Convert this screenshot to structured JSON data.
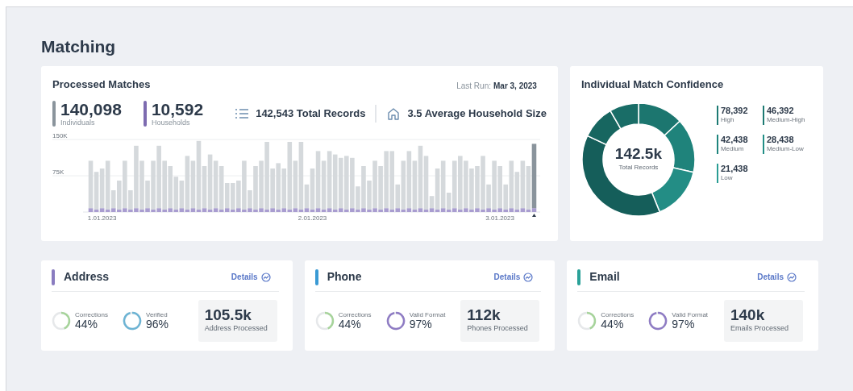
{
  "page_title": "Matching",
  "processed_matches": {
    "title": "Processed Matches",
    "last_run_label": "Last Run:",
    "last_run_value": "Mar 3, 2023",
    "stats": [
      {
        "value": "140,098",
        "label": "Individuals",
        "color": "#8a949c"
      },
      {
        "value": "10,592",
        "label": "Households",
        "color": "#7d6bb0"
      }
    ],
    "summary": [
      {
        "kind": "list",
        "text": "142,543 Total Records"
      },
      {
        "kind": "house",
        "text": "3.5 Average Household Size"
      }
    ],
    "chart_data": {
      "type": "bar",
      "stacked": true,
      "grid": true,
      "ylim": [
        0,
        150000
      ],
      "yticks": [
        {
          "value": 75000,
          "label": "75K"
        },
        {
          "value": 150000,
          "label": "150K"
        }
      ],
      "categories": [
        null,
        null,
        "1.01.2023",
        null,
        null,
        null,
        null,
        null,
        null,
        null,
        null,
        null,
        null,
        null,
        null,
        null,
        null,
        null,
        null,
        null,
        null,
        null,
        null,
        null,
        null,
        null,
        null,
        null,
        null,
        null,
        null,
        null,
        null,
        null,
        null,
        null,
        null,
        null,
        null,
        "2.01.2023",
        null,
        null,
        null,
        null,
        null,
        null,
        null,
        null,
        null,
        null,
        null,
        null,
        null,
        null,
        null,
        null,
        null,
        null,
        null,
        null,
        null,
        null,
        null,
        null,
        null,
        null,
        null,
        null,
        null,
        null,
        null,
        null,
        "3.01.2023",
        null,
        null,
        null,
        null,
        null,
        null
      ],
      "series": [
        {
          "color": "#a99dd0",
          "values": [
            8000,
            5000,
            8000,
            5000,
            8000,
            5000,
            8000,
            5000,
            8000,
            5000,
            8000,
            5000,
            8000,
            5000,
            8000,
            5000,
            8000,
            5000,
            8000,
            5000,
            8000,
            5000,
            8000,
            5000,
            8000,
            5000,
            8000,
            5000,
            8000,
            5000,
            8000,
            5000,
            8000,
            5000,
            8000,
            5000,
            8000,
            5000,
            8000,
            5000,
            8000,
            5000,
            8000,
            5000,
            8000,
            5000,
            8000,
            5000,
            8000,
            5000,
            8000,
            5000,
            8000,
            5000,
            8000,
            5000,
            8000,
            5000,
            8000,
            5000,
            8000,
            5000,
            8000,
            5000,
            8000,
            5000,
            8000,
            5000,
            8000,
            5000,
            8000,
            5000,
            8000,
            5000,
            8000,
            5000,
            8000,
            5000,
            8000
          ]
        },
        {
          "color": "#d5d9dc",
          "values": [
            98000,
            78000,
            82000,
            101000,
            37000,
            60000,
            98000,
            40000,
            129000,
            101000,
            57000,
            101000,
            129000,
            101000,
            87000,
            68000,
            57000,
            111000,
            98000,
            142000,
            87000,
            114000,
            98000,
            90000,
            52000,
            55000,
            57000,
            101000,
            37000,
            90000,
            98000,
            140000,
            82000,
            96000,
            82000,
            140000,
            98000,
            140000,
            49000,
            85000,
            118000,
            101000,
            118000,
            114000,
            104000,
            111000,
            104000,
            48000,
            87000,
            60000,
            98000,
            90000,
            118000,
            121000,
            49000,
            101000,
            118000,
            101000,
            129000,
            111000,
            25000,
            85000,
            98000,
            35000,
            98000,
            111000,
            98000,
            85000,
            87000,
            111000,
            49000,
            101000,
            87000,
            52000,
            98000,
            78000,
            98000,
            90000,
            null
          ]
        },
        {
          "color": "#8a949c",
          "values": [
            null,
            null,
            null,
            null,
            null,
            null,
            null,
            null,
            null,
            null,
            null,
            null,
            null,
            null,
            null,
            null,
            null,
            null,
            null,
            null,
            null,
            null,
            null,
            null,
            null,
            null,
            null,
            null,
            null,
            null,
            null,
            null,
            null,
            null,
            null,
            null,
            null,
            null,
            null,
            null,
            null,
            null,
            null,
            null,
            null,
            null,
            null,
            null,
            null,
            null,
            null,
            null,
            null,
            null,
            null,
            null,
            null,
            null,
            null,
            null,
            null,
            null,
            null,
            null,
            null,
            null,
            null,
            null,
            null,
            null,
            null,
            null,
            null,
            null,
            null,
            null,
            null,
            null,
            133000
          ]
        }
      ]
    }
  },
  "confidence": {
    "title": "Individual Match Confidence",
    "center_value": "142.5k",
    "center_label": "Total Records",
    "legend": [
      {
        "value": "78,392",
        "label": "High",
        "color": "#1d7a73"
      },
      {
        "value": "46,392",
        "label": "Medium-High",
        "color": "#1d7a73"
      },
      {
        "value": "42,438",
        "label": "Medium",
        "color": "#1f857d"
      },
      {
        "value": "28,438",
        "label": "Medium-Low",
        "color": "#238f87"
      },
      {
        "value": "21,438",
        "label": "Low",
        "color": "#2a9d94"
      }
    ]
  },
  "cards": [
    {
      "title": "Address",
      "color": "#8a7cc0",
      "link": "Details",
      "metrics": [
        {
          "label": "Corrections",
          "value": "44%",
          "level": 0.44,
          "color": "#a6d49a"
        },
        {
          "label": "Verified",
          "value": "96%",
          "level": 0.96,
          "color": "#6db4d4"
        }
      ],
      "total": "105.5k",
      "total_label": "Address Processed"
    },
    {
      "title": "Phone",
      "color": "#3a9ad4",
      "link": "Details",
      "metrics": [
        {
          "label": "Corrections",
          "value": "44%",
          "level": 0.44,
          "color": "#a6d49a"
        },
        {
          "label": "Valid Format",
          "value": "97%",
          "level": 0.97,
          "color": "#8f7cc4"
        }
      ],
      "total": "112k",
      "total_label": "Phones Processed"
    },
    {
      "title": "Email",
      "color": "#2aa198",
      "link": "Details",
      "metrics": [
        {
          "label": "Corrections",
          "value": "44%",
          "level": 0.44,
          "color": "#a6d49a"
        },
        {
          "label": "Valid Format",
          "value": "97%",
          "level": 0.97,
          "color": "#8f7cc4"
        }
      ],
      "total": "140k",
      "total_label": "Emails Processed"
    }
  ]
}
